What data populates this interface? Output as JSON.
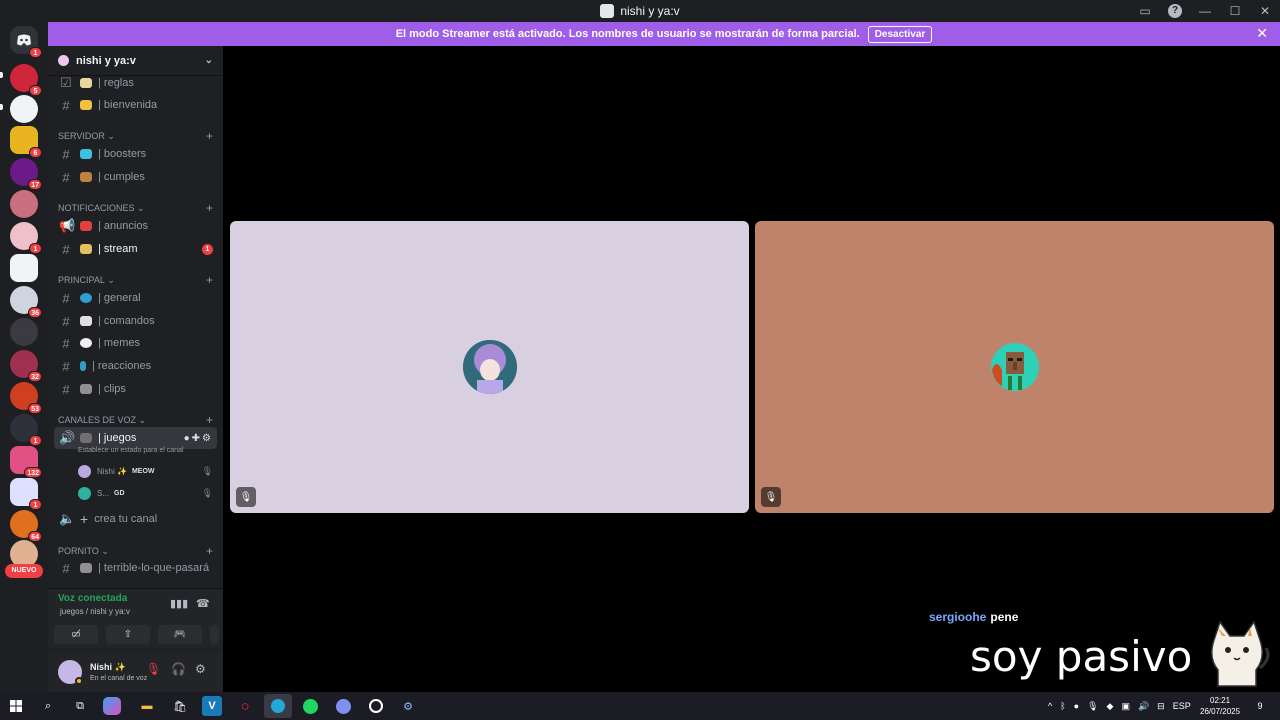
{
  "window": {
    "title": "nishi y ya:v"
  },
  "banner": {
    "text": "El modo Streamer está activado. Los nombres de usuario se mostrarán de forma parcial.",
    "button": "Desactivar"
  },
  "servers": {
    "home_badge": "1",
    "badges": [
      "5",
      "6",
      "17",
      "1",
      "36",
      "32",
      "53",
      "1",
      "132",
      "1",
      "64"
    ],
    "new_label": "NUEVO"
  },
  "sidebar": {
    "server_name": "nishi y ya:v",
    "channels_top": [
      {
        "name": "| reglas"
      },
      {
        "name": "| bienvenida"
      }
    ],
    "categories": {
      "servidor": "SERVIDOR",
      "notificaciones": "NOTIFICACIONES",
      "principal": "PRINCIPAL",
      "voz": "CANALES DE VOZ",
      "pornito": "PORNITO"
    },
    "servidor_channels": [
      "| boosters",
      "| cumples"
    ],
    "notif_channels": [
      "| anuncios",
      "| stream"
    ],
    "stream_unread": "1",
    "principal_channels": [
      "| general",
      "| comandos",
      "| memes",
      "| reacciones",
      "| clips"
    ],
    "voice_channel": "| juegos",
    "voice_status_hint": "Establece un estado para el canal",
    "voice_users": [
      {
        "name": "Nishi ✨",
        "tag": "MEOW"
      },
      {
        "name": "S...",
        "tag": "GD"
      }
    ],
    "create_channel": "crea tu canal",
    "pornito_channel": "| terrible-lo-que-pasará"
  },
  "voice_panel": {
    "title": "Voz conectada",
    "subtitle": "juegos / nishi y ya:v"
  },
  "user": {
    "name": "Nishi ✨",
    "status": "En el canal de voz"
  },
  "stage": {
    "overlay_user": "sergioohe",
    "overlay_msg": "pene",
    "big_text": "soy pasivo"
  },
  "colors": {
    "banner": "#a05ee8",
    "tile_left": "#d8d0e0",
    "tile_right": "#bf836b",
    "connected": "#23a55a",
    "badge": "#f23f43"
  },
  "taskbar": {
    "lang": "ESP",
    "time": "02:21",
    "date": "26/07/2025",
    "notif_count": "9"
  }
}
